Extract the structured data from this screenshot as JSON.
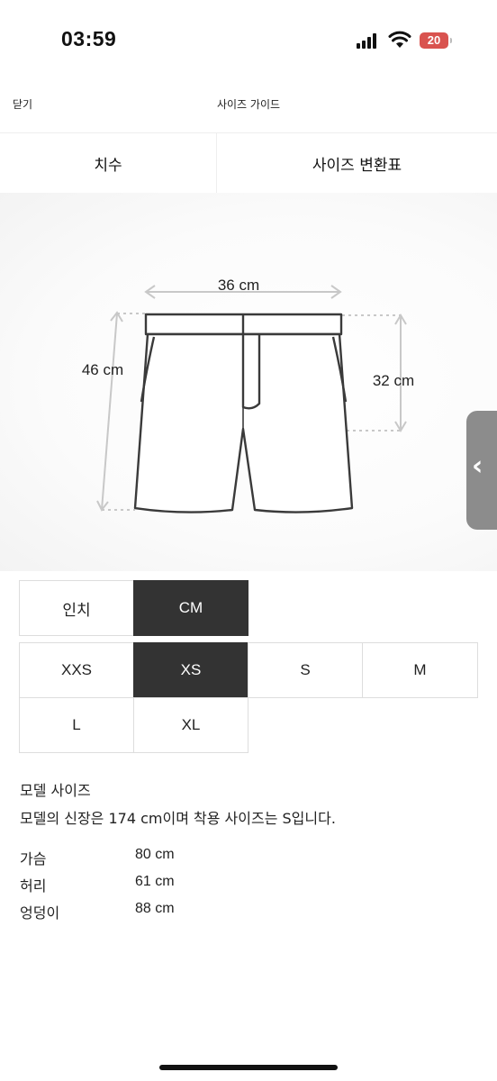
{
  "status": {
    "time": "03:59",
    "battery": "20"
  },
  "header": {
    "close_label": "닫기",
    "title": "사이즈 가이드"
  },
  "tabs": [
    {
      "label": "치수"
    },
    {
      "label": "사이즈 변환표"
    }
  ],
  "diagram": {
    "width_label": "36 cm",
    "length_label": "46 cm",
    "rise_label": "32 cm"
  },
  "units": [
    {
      "label": "인치",
      "active": false
    },
    {
      "label": "CM",
      "active": true
    }
  ],
  "sizes": [
    {
      "label": "XXS",
      "active": false
    },
    {
      "label": "XS",
      "active": true
    },
    {
      "label": "S",
      "active": false
    },
    {
      "label": "M",
      "active": false
    },
    {
      "label": "L",
      "active": false
    },
    {
      "label": "XL",
      "active": false
    }
  ],
  "model": {
    "title": "모델 사이즈",
    "description": "모델의 신장은 174 cm이며 착용 사이즈는 S입니다.",
    "measurements": [
      {
        "label": "가슴",
        "value": "80 cm"
      },
      {
        "label": "허리",
        "value": "61 cm"
      },
      {
        "label": "엉덩이",
        "value": "88 cm"
      }
    ]
  },
  "side_handle": {
    "icon": "chevron-left-icon"
  },
  "colors": {
    "active_bg": "#333333",
    "battery": "#d9534f"
  }
}
